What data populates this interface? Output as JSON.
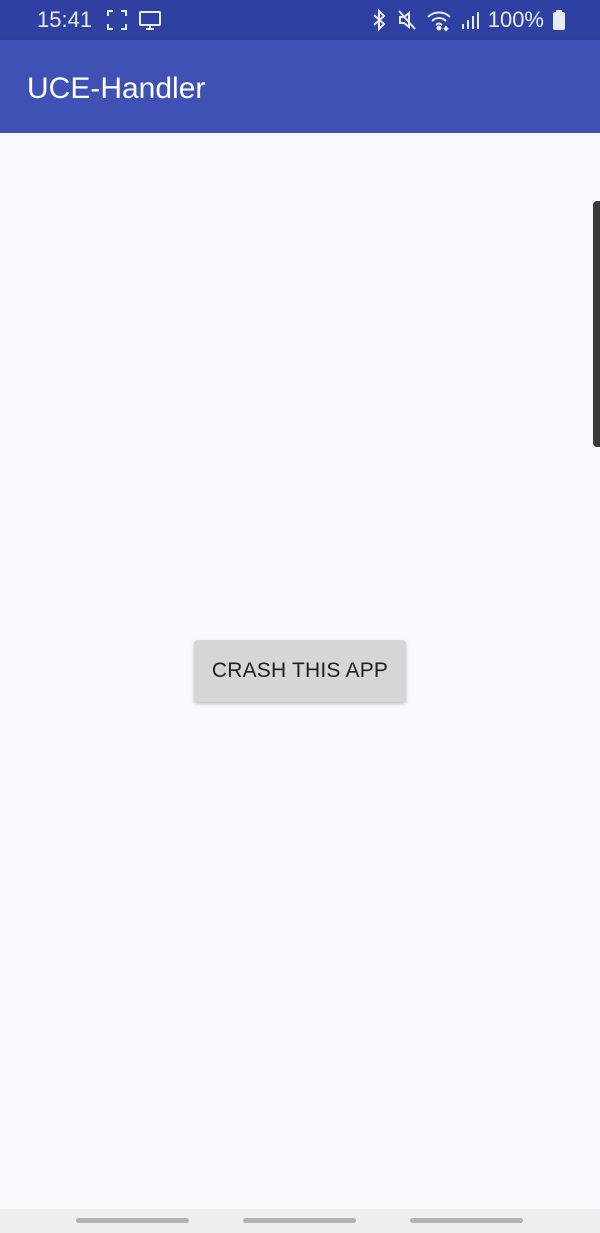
{
  "status_bar": {
    "time": "15:41",
    "battery_text": "100%",
    "icons": [
      "screenshot-frame-icon",
      "cast-monitor-icon",
      "bluetooth-icon",
      "mute-icon",
      "wifi-icon",
      "signal-icon",
      "battery-icon"
    ]
  },
  "app_bar": {
    "title": "UCE-Handler",
    "color": "#3f51b5"
  },
  "main": {
    "crash_button_label": "CRASH THIS APP"
  },
  "navigation": {
    "handles": [
      "recent-apps",
      "home",
      "back"
    ]
  },
  "colors": {
    "status_bar": "#2f40a3",
    "app_bar": "#3f51b5",
    "background": "#f9f8fb",
    "button": "#d6d6d6"
  }
}
